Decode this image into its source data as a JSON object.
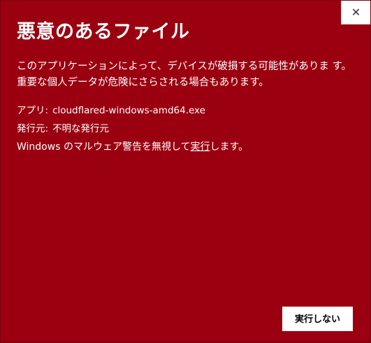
{
  "dialog": {
    "close_symbol": "✕",
    "title": "悪意のあるファイル",
    "description": "このアプリケーションによって、デバイスが破損する可能性がありま す。重要な個人データが危険にさらされる場合もあります。",
    "app_label": "アプリ:",
    "app_value": "cloudflared-windows-amd64.exe",
    "publisher_label": "発行元:",
    "publisher_value": "不明な発行元",
    "run_anyway_prefix": "Windows のマルウェア警告を無視して",
    "run_anyway_link": "実行",
    "run_anyway_suffix": "します。",
    "dont_run_label": "実行しない"
  },
  "colors": {
    "background": "#9b0010",
    "button": "#ffffff"
  }
}
